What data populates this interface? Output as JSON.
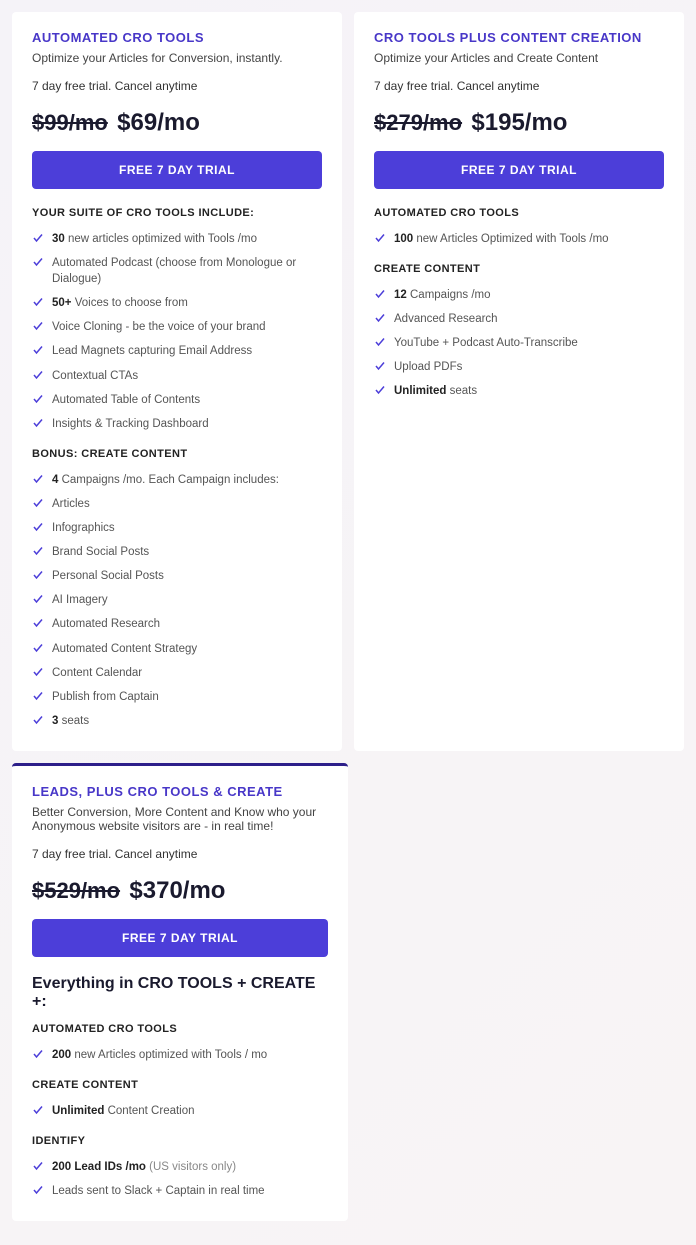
{
  "plans": {
    "cro": {
      "title": "AUTOMATED CRO TOOLS",
      "subtitle": "Optimize your Articles for Conversion, instantly.",
      "trial": "7 day free trial. Cancel anytime",
      "price_strike": "$99/mo",
      "price_now": "$69/mo",
      "cta": "FREE 7 DAY TRIAL",
      "section1_head": "YOUR SUITE OF CRO TOOLS INCLUDE:",
      "section1": [
        {
          "bold": "30",
          "rest": " new articles optimized with Tools /mo"
        },
        {
          "bold": "",
          "rest": "Automated Podcast (choose from Monologue or Dialogue)"
        },
        {
          "bold": "50+",
          "rest": " Voices to choose from"
        },
        {
          "bold": "",
          "rest": "Voice Cloning - be the voice of your brand"
        },
        {
          "bold": "",
          "rest": "Lead Magnets capturing Email Address"
        },
        {
          "bold": "",
          "rest": "Contextual CTAs"
        },
        {
          "bold": "",
          "rest": "Automated Table of Contents"
        },
        {
          "bold": "",
          "rest": "Insights & Tracking Dashboard"
        }
      ],
      "section2_head": "BONUS: CREATE CONTENT",
      "section2": [
        {
          "bold": "4",
          "rest": " Campaigns /mo. Each Campaign includes:"
        },
        {
          "bold": "",
          "rest": "Articles"
        },
        {
          "bold": "",
          "rest": "Infographics"
        },
        {
          "bold": "",
          "rest": "Brand Social Posts"
        },
        {
          "bold": "",
          "rest": "Personal Social Posts"
        },
        {
          "bold": "",
          "rest": "AI Imagery"
        },
        {
          "bold": "",
          "rest": "Automated Research"
        },
        {
          "bold": "",
          "rest": "Automated Content Strategy"
        },
        {
          "bold": "",
          "rest": "Content Calendar"
        },
        {
          "bold": "",
          "rest": "Publish from Captain"
        },
        {
          "bold": "3",
          "rest": " seats"
        }
      ]
    },
    "plus": {
      "title": "CRO TOOLS PLUS CONTENT CREATION",
      "subtitle": "Optimize your Articles and Create Content",
      "trial": "7 day free trial. Cancel anytime",
      "price_strike": "$279/mo",
      "price_now": "$195/mo",
      "cta": "FREE 7 DAY TRIAL",
      "section1_head": "AUTOMATED CRO TOOLS",
      "section1": [
        {
          "bold": "100",
          "rest": " new Articles Optimized with Tools /mo"
        }
      ],
      "section2_head": "CREATE CONTENT",
      "section2": [
        {
          "bold": "12",
          "rest": " Campaigns /mo"
        },
        {
          "bold": "",
          "rest": "Advanced Research"
        },
        {
          "bold": "",
          "rest": "YouTube + Podcast Auto-Transcribe"
        },
        {
          "bold": "",
          "rest": "Upload PDFs"
        },
        {
          "bold": "Unlimited",
          "rest": " seats"
        }
      ]
    },
    "leads": {
      "title": "LEADS, PLUS CRO TOOLS & CREATE",
      "subtitle": "Better Conversion, More Content and Know who your Anonymous website visitors are - in real time!",
      "trial": "7 day free trial. Cancel anytime",
      "price_strike": "$529/mo",
      "price_now": "$370/mo",
      "cta": "FREE 7 DAY TRIAL",
      "bighead": "Everything in CRO TOOLS + CREATE +:",
      "sec1_head": "AUTOMATED CRO TOOLS",
      "sec1": [
        {
          "bold": "200",
          "rest": " new Articles optimized with Tools / mo"
        }
      ],
      "sec2_head": "CREATE CONTENT",
      "sec2": [
        {
          "bold": "Unlimited",
          "rest": " Content Creation"
        }
      ],
      "sec3_head": "IDENTIFY",
      "sec3": [
        {
          "bold": "200 Lead IDs /mo",
          "rest": " (US visitors only)",
          "light": true
        },
        {
          "bold": "",
          "rest": "Leads sent to Slack + Captain in real time"
        }
      ]
    }
  }
}
